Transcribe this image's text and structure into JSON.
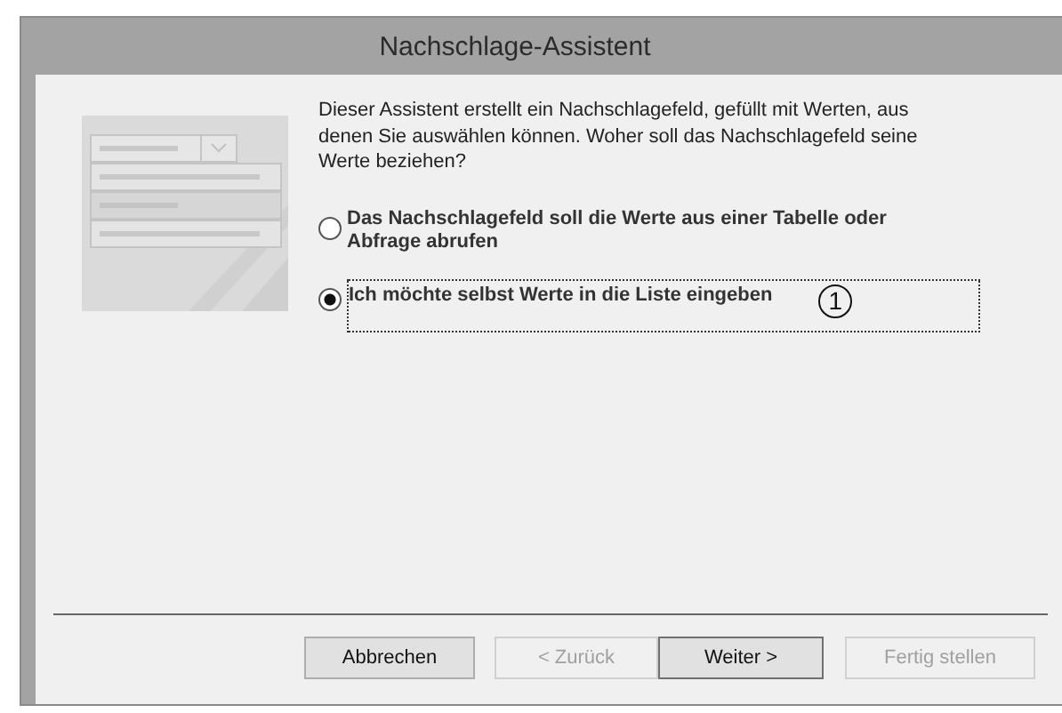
{
  "window": {
    "title": "Nachschlage-Assistent"
  },
  "intro": "Dieser Assistent erstellt ein Nachschlagefeld, gefüllt mit Werten, aus denen Sie auswählen können. Woher soll das Nachschlagefeld seine Werte beziehen?",
  "options": [
    {
      "label": "Das Nachschlagefeld soll die Werte aus einer Tabelle oder Abfrage abrufen",
      "selected": false
    },
    {
      "label": "Ich möchte selbst Werte in die Liste eingeben",
      "selected": true,
      "callout": "1"
    }
  ],
  "buttons": [
    {
      "label": "Abbrechen",
      "disabled": false,
      "default": false
    },
    {
      "label": "< Zurück",
      "disabled": true,
      "default": false
    },
    {
      "label": "Weiter >",
      "disabled": false,
      "default": true
    },
    {
      "label": "Fertig stellen",
      "disabled": true,
      "default": false
    }
  ]
}
